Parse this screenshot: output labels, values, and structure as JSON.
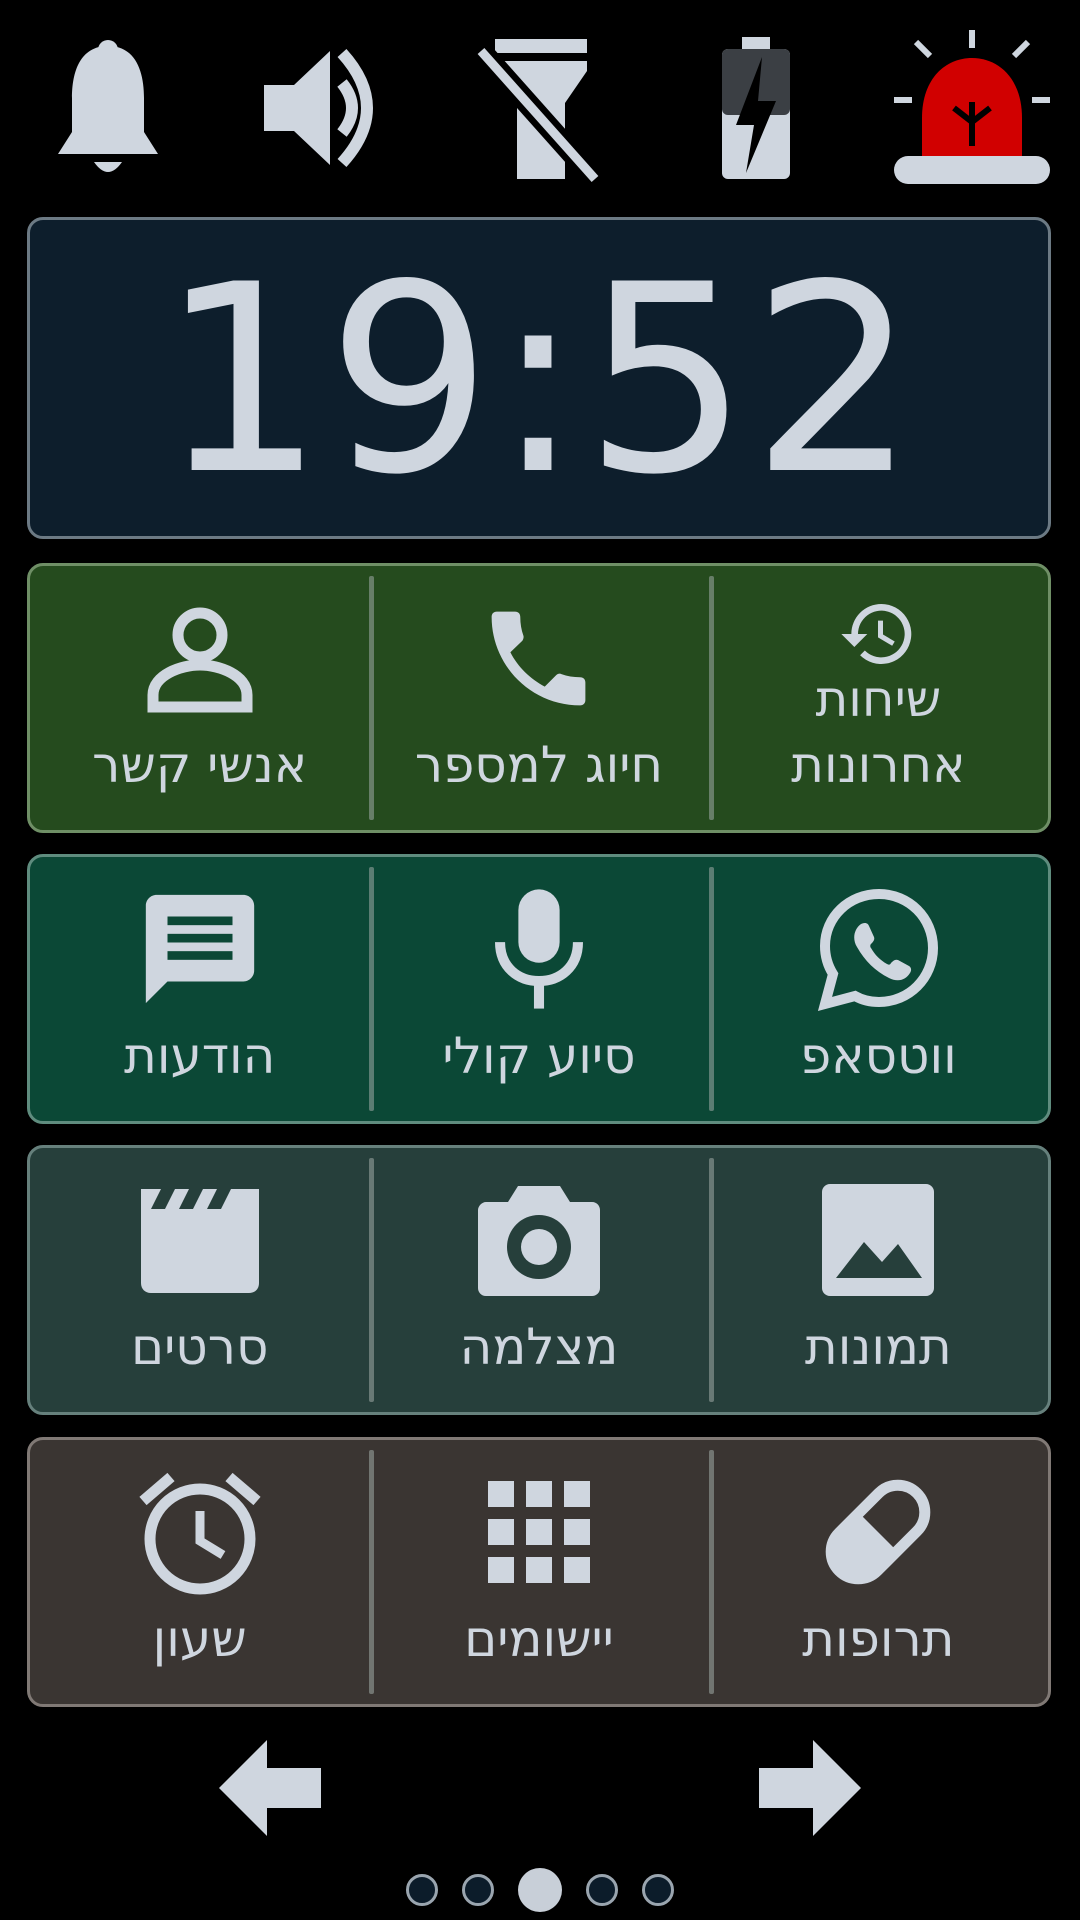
{
  "status_icons": [
    {
      "name": "bell-icon"
    },
    {
      "name": "volume-icon"
    },
    {
      "name": "flashlight-off-icon"
    },
    {
      "name": "battery-charging-icon"
    },
    {
      "name": "emergency-siren-icon",
      "color": "#d10000"
    }
  ],
  "clock": {
    "time": "19:52"
  },
  "rows": [
    {
      "color": "#254b1e",
      "tiles": [
        {
          "icon": "contact-person-icon",
          "label": "אנשי קשר"
        },
        {
          "icon": "phone-icon",
          "label": "חיוג למספר"
        },
        {
          "icon": "history-icon",
          "label_line1": "שיחות",
          "label_line2": "אחרונות"
        }
      ]
    },
    {
      "color": "#0b4836",
      "tiles": [
        {
          "icon": "message-icon",
          "label": "הודעות"
        },
        {
          "icon": "microphone-icon",
          "label": "סיוע קולי"
        },
        {
          "icon": "whatsapp-icon",
          "label": "ווטסאפ"
        }
      ]
    },
    {
      "color": "#263f3b",
      "tiles": [
        {
          "icon": "movie-clapper-icon",
          "label": "סרטים"
        },
        {
          "icon": "camera-icon",
          "label": "מצלמה"
        },
        {
          "icon": "image-icon",
          "label": "תמונות"
        }
      ]
    },
    {
      "color": "#3a3532",
      "tiles": [
        {
          "icon": "alarm-clock-icon",
          "label": "שעון"
        },
        {
          "icon": "apps-grid-icon",
          "label": "יישומים"
        },
        {
          "icon": "pill-icon",
          "label": "תרופות"
        }
      ]
    }
  ],
  "navigation": {
    "prev": "arrow-left-icon",
    "next": "arrow-right-icon",
    "pages": 5,
    "current_page": 3
  }
}
